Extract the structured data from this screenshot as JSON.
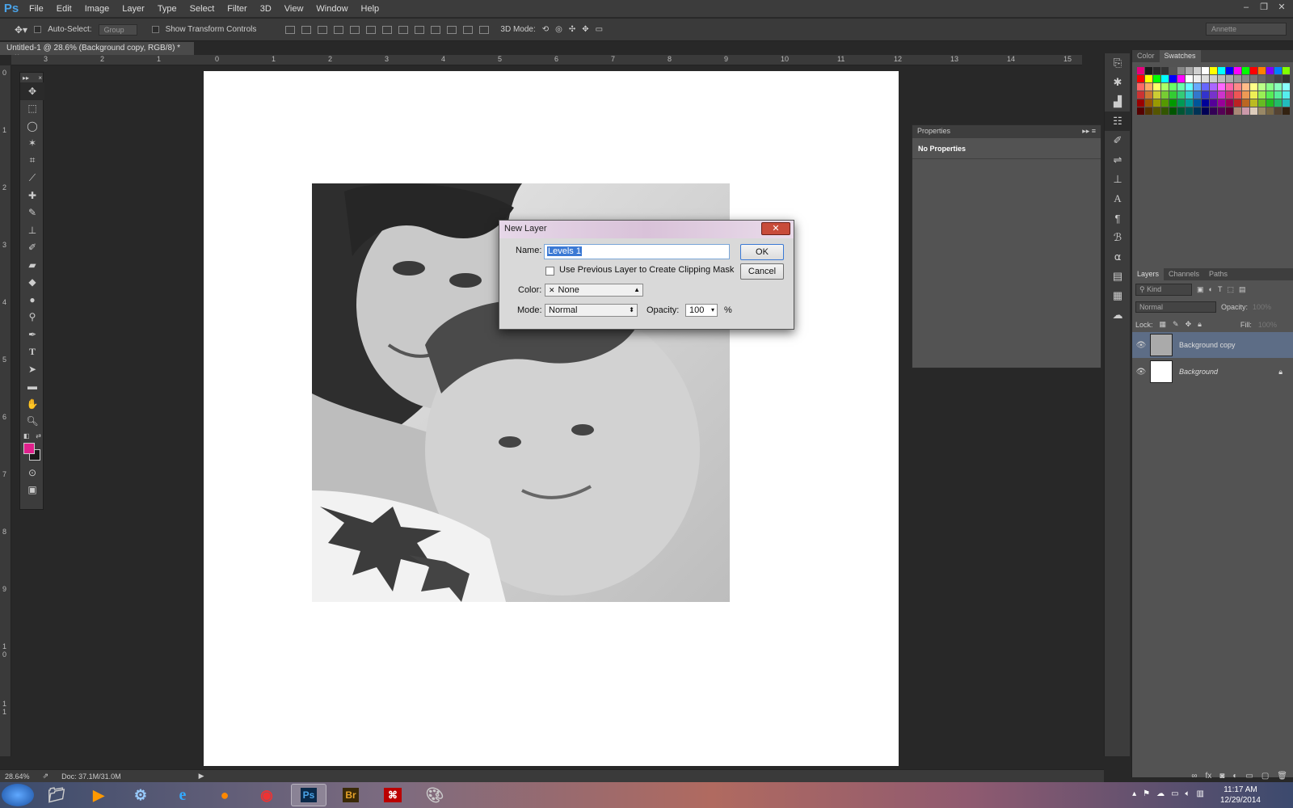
{
  "app": {
    "logo": "Ps"
  },
  "menu": [
    "File",
    "Edit",
    "Image",
    "Layer",
    "Type",
    "Select",
    "Filter",
    "3D",
    "View",
    "Window",
    "Help"
  ],
  "window_controls": [
    "–",
    "❐",
    "✕"
  ],
  "options": {
    "auto_select_label": "Auto-Select:",
    "auto_select_value": "Group",
    "show_transform_label": "Show Transform Controls",
    "mode_3d_label": "3D Mode:",
    "workspace": "Annette"
  },
  "document_tab": {
    "title": "Untitled-1 @ 28.6% (Background copy, RGB/8) *",
    "close": "×"
  },
  "ruler_top_labels": [
    "3",
    "2",
    "1",
    "0",
    "1",
    "2",
    "3",
    "4",
    "5",
    "6",
    "7",
    "8",
    "9",
    "10",
    "11",
    "12",
    "13",
    "14",
    "15"
  ],
  "ruler_left_labels": [
    "0",
    "1",
    "2",
    "3",
    "4",
    "5",
    "6",
    "7",
    "8",
    "9",
    "1 0",
    "1 1"
  ],
  "colors": {
    "foreground": "#e0208c",
    "background": "#1a1a1a",
    "accent": "#3b79d4"
  },
  "properties": {
    "title": "Properties",
    "body": "No Properties"
  },
  "color_panel": {
    "tabs": [
      "Color",
      "Swatches"
    ],
    "active_tab": "Swatches"
  },
  "layers_panel": {
    "tabs": [
      "Layers",
      "Channels",
      "Paths"
    ],
    "kind_label": "Kind",
    "blend_mode": "Normal",
    "opacity_label": "Opacity:",
    "opacity_value": "100%",
    "lock_label": "Lock:",
    "fill_label": "Fill:",
    "fill_value": "100%",
    "layers": [
      {
        "name": "Background copy",
        "selected": true
      },
      {
        "name": "Background",
        "selected": false,
        "locked": true
      }
    ]
  },
  "status": {
    "zoom": "28.64%",
    "doc": "Doc: 37.1M/31.0M"
  },
  "dialog": {
    "title": "New Layer",
    "name_label": "Name:",
    "name_value": "Levels 1",
    "clip_label": "Use Previous Layer to Create Clipping Mask",
    "color_label": "Color:",
    "color_value": "None",
    "mode_label": "Mode:",
    "mode_value": "Normal",
    "opacity_label": "Opacity:",
    "opacity_value": "100",
    "percent": "%",
    "ok": "OK",
    "cancel": "Cancel"
  },
  "taskbar": {
    "apps": [
      "start-orb",
      "explorer",
      "media-player",
      "network",
      "internet-explorer",
      "firefox",
      "chrome",
      "photoshop",
      "bridge",
      "acrobat",
      "paint"
    ],
    "ps_label": "Ps",
    "br_label": "Br",
    "time": "11:17 AM",
    "date": "12/29/2014"
  }
}
